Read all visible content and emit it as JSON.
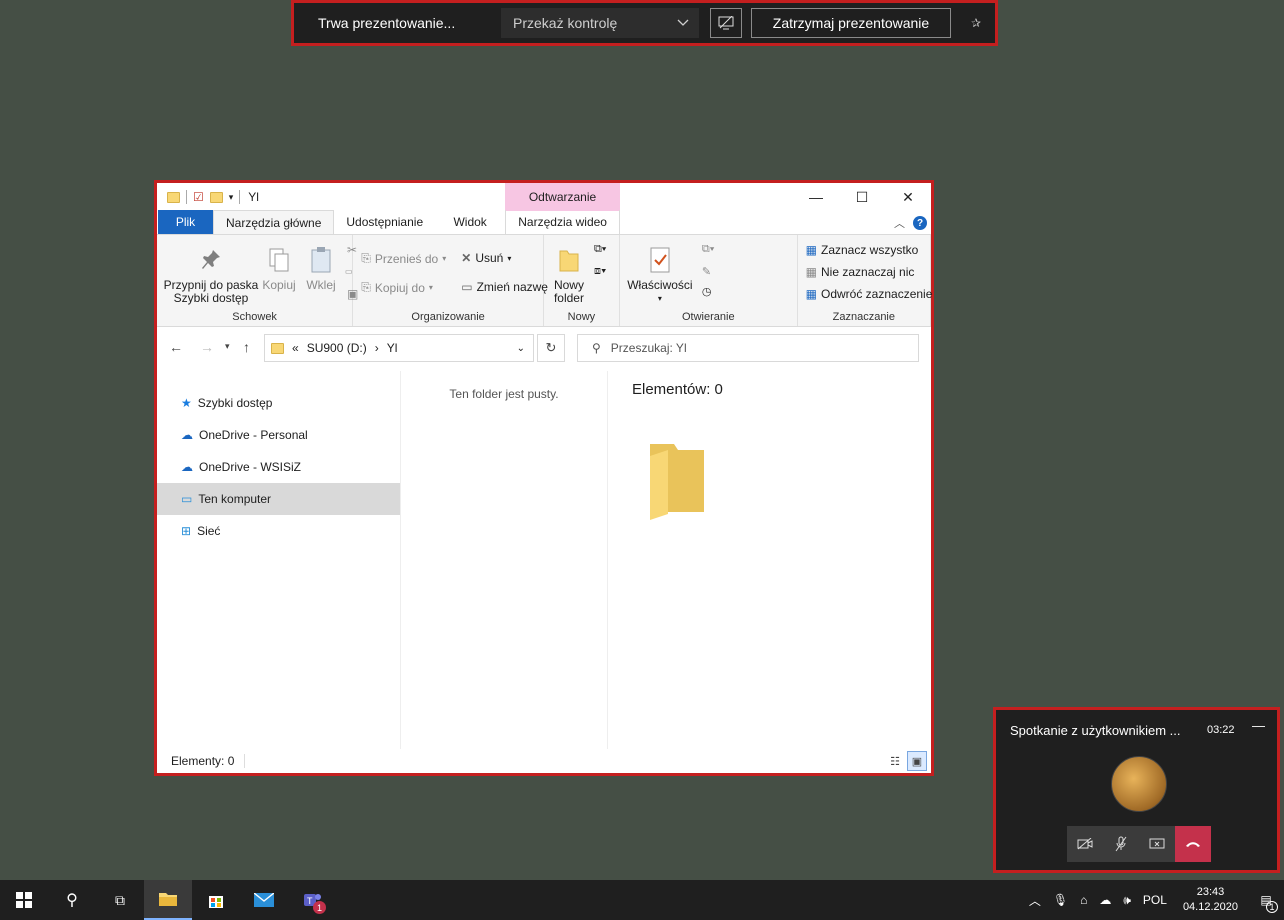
{
  "presenting_bar": {
    "status": "Trwa prezentowanie...",
    "control_select": "Przekaż kontrolę",
    "stop_label": "Zatrzymaj prezentowanie"
  },
  "explorer": {
    "title": "Yl",
    "contextual_tab_header": "Odtwarzanie",
    "tabs": [
      "Plik",
      "Narzędzia główne",
      "Udostępnianie",
      "Widok",
      "Narzędzia wideo"
    ],
    "ribbon": {
      "clipboard": {
        "group": "Schowek",
        "pin": "Przypnij do paska Szybki dostęp",
        "copy": "Kopiuj",
        "paste": "Wklej"
      },
      "organize": {
        "group": "Organizowanie",
        "move_to": "Przenieś do",
        "copy_to": "Kopiuj do",
        "delete": "Usuń",
        "rename": "Zmień nazwę"
      },
      "new": {
        "group": "Nowy",
        "new_folder": "Nowy folder"
      },
      "open": {
        "group": "Otwieranie",
        "properties": "Właściwości"
      },
      "select": {
        "group": "Zaznaczanie",
        "select_all": "Zaznacz wszystko",
        "select_none": "Nie zaznaczaj nic",
        "invert": "Odwróć zaznaczenie"
      }
    },
    "address": {
      "prefix": "«",
      "drive": "SU900 (D:)",
      "folder": "Yl"
    },
    "search_placeholder": "Przeszukaj: Yl",
    "nav_items": [
      "Szybki dostęp",
      "OneDrive - Personal",
      "OneDrive - WSISiZ",
      "Ten komputer",
      "Sieć"
    ],
    "empty_text": "Ten folder jest pusty.",
    "preview_count": "Elementów: 0",
    "status": "Elementy: 0"
  },
  "meeting": {
    "title": "Spotkanie z użytkownikiem ...",
    "time": "03:22"
  },
  "taskbar": {
    "teams_badge": "1",
    "language": "POL",
    "time": "23:43",
    "date": "04.12.2020",
    "notifications": "1"
  },
  "colors": {
    "accent": "#1a66c0",
    "highlight_border": "#c41f1f",
    "desktop": "#454f45",
    "hangup": "#c4314b"
  }
}
